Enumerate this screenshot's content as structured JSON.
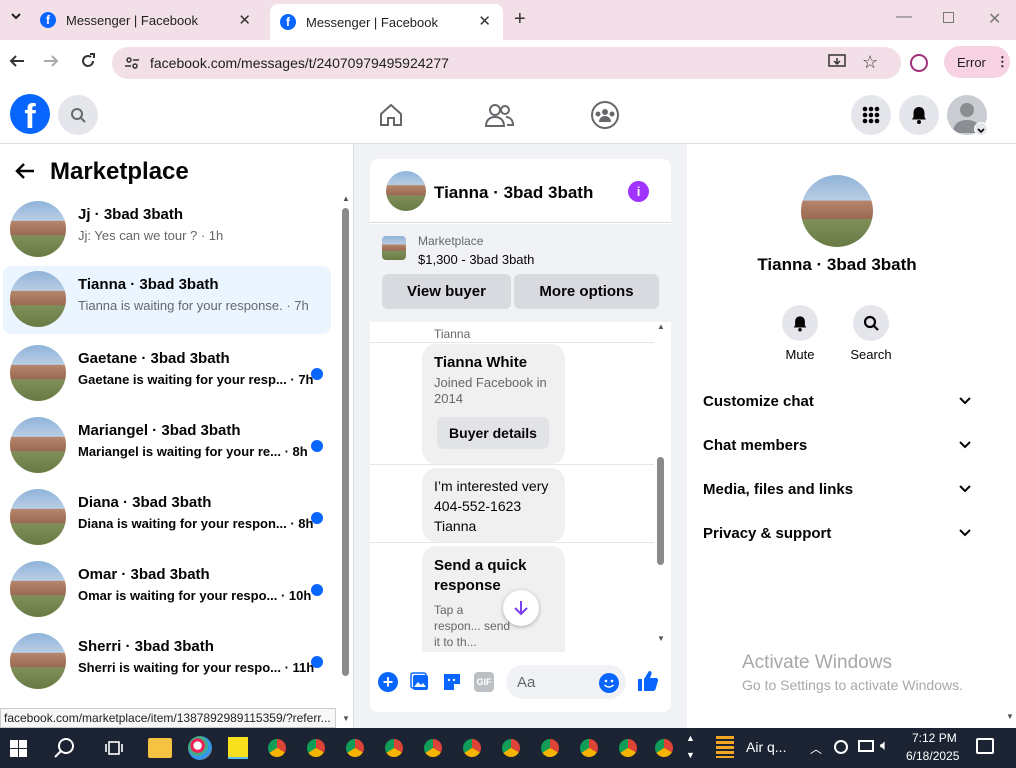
{
  "browser": {
    "tabs": [
      {
        "title": "Messenger | Facebook"
      },
      {
        "title": "Messenger | Facebook"
      }
    ],
    "url": "facebook.com/messages/t/24070979495924277",
    "error_label": "Error",
    "status_url": "facebook.com/marketplace/item/1387892989115359/?referr..."
  },
  "sidebar": {
    "title": "Marketplace",
    "conversations": [
      {
        "name": "Jj · 3bad 3bath",
        "preview": "Jj: Yes can we tour ? · 1h",
        "unread": false
      },
      {
        "name": "Tianna · 3bad 3bath",
        "preview": "Tianna is waiting for your response. · 7h",
        "unread": false,
        "selected": true
      },
      {
        "name": "Gaetane · 3bad 3bath",
        "preview": "Gaetane is waiting for your resp... · 7h",
        "unread": true
      },
      {
        "name": "Mariangel · 3bad 3bath",
        "preview": "Mariangel is waiting for your re... · 8h",
        "unread": true
      },
      {
        "name": "Diana · 3bad 3bath",
        "preview": "Diana is waiting for your respon... · 8h",
        "unread": true
      },
      {
        "name": "Omar · 3bad 3bath",
        "preview": "Omar is waiting for your respo... · 10h",
        "unread": true
      },
      {
        "name": "Sherri · 3bad 3bath",
        "preview": "Sherri is waiting for your respo... · 11h",
        "unread": true
      }
    ]
  },
  "chat": {
    "title": "Tianna · 3bad 3bath",
    "listing_label": "Marketplace",
    "listing_price": "$1,300 - 3bad 3bath",
    "view_buyer": "View buyer",
    "more_options": "More options",
    "sender_label": "Tianna",
    "card_name": "Tianna White",
    "card_joined": "Joined Facebook in 2014",
    "buyer_details": "Buyer details",
    "message": "I’m interested very  404-552-1623 Tianna",
    "quick_title": "Send a quick response",
    "quick_text": "Tap a respon... send it to th... buyer.",
    "input_placeholder": "Aa"
  },
  "info_panel": {
    "name": "Tianna · 3bad 3bath",
    "mute": "Mute",
    "search": "Search",
    "rows": [
      "Customize chat",
      "Chat members",
      "Media, files and links",
      "Privacy & support"
    ]
  },
  "watermark": {
    "title": "Activate Windows",
    "subtitle": "Go to Settings to activate Windows."
  },
  "taskbar": {
    "app_label": "Air q...",
    "time": "7:12 PM",
    "date": "6/18/2025"
  },
  "colors": {
    "accent": "#0866ff",
    "purple": "#a033ff"
  }
}
